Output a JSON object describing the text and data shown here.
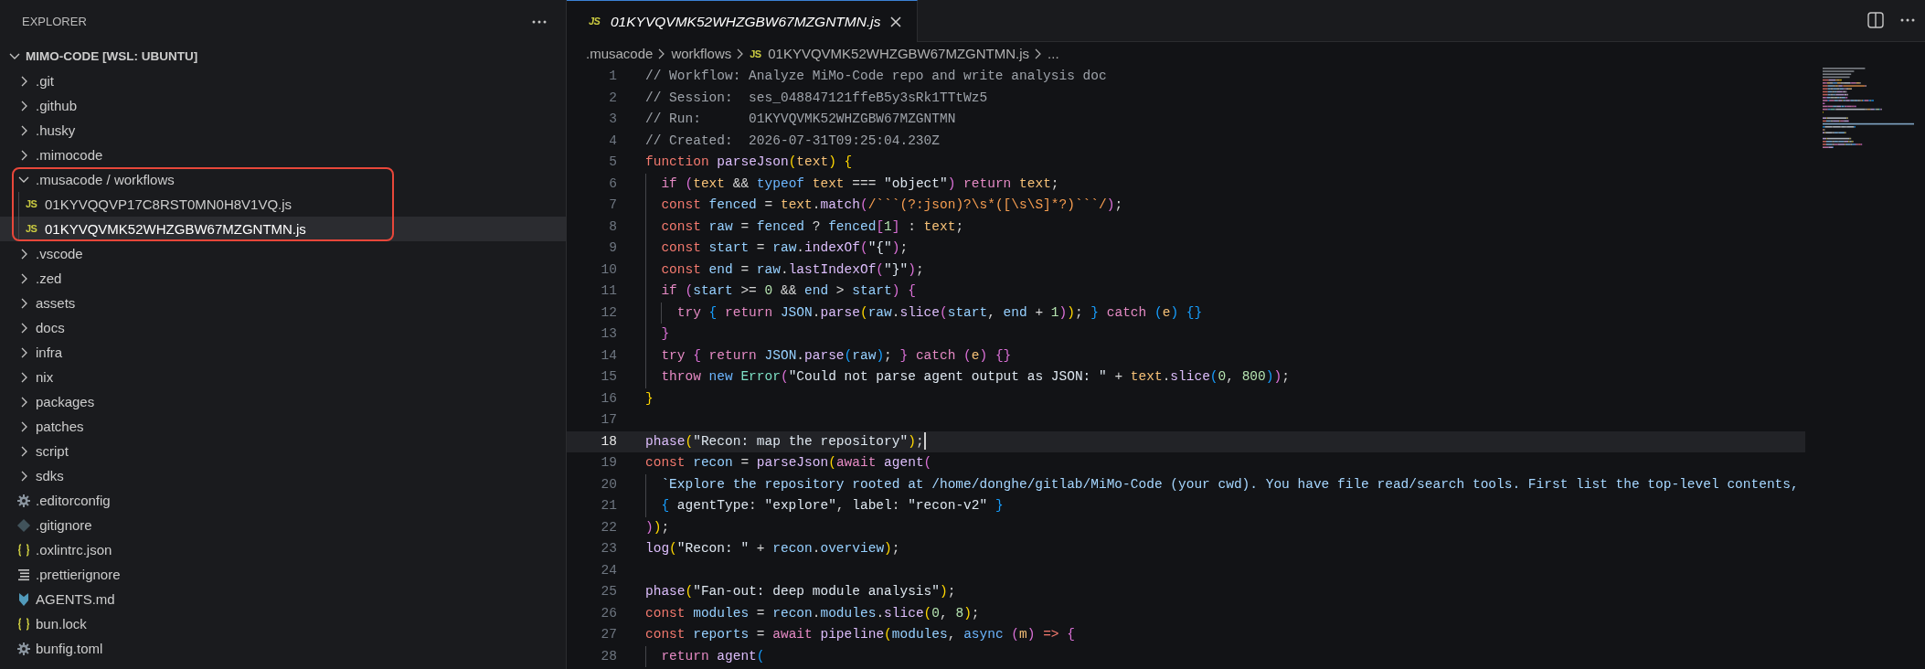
{
  "explorer": {
    "title": "EXPLORER",
    "root": {
      "label": "MIMO-CODE [WSL: UBUNTU]",
      "expanded": true,
      "children": [
        {
          "label": ".git",
          "kind": "folder",
          "expanded": false
        },
        {
          "label": ".github",
          "kind": "folder",
          "expanded": false
        },
        {
          "label": ".husky",
          "kind": "folder",
          "expanded": false
        },
        {
          "label": ".mimocode",
          "kind": "folder",
          "expanded": false
        },
        {
          "label": ".musacode / workflows",
          "kind": "folder",
          "expanded": true,
          "annotated": true,
          "children": [
            {
              "label": "01KYVQQVP17C8RST0MN0H8V1VQ.js",
              "kind": "js",
              "badge": "JS",
              "selected": false
            },
            {
              "label": "01KYVQVMK52WHZGBW67MZGNTMN.js",
              "kind": "js",
              "badge": "JS",
              "selected": true
            }
          ]
        },
        {
          "label": ".vscode",
          "kind": "folder",
          "expanded": false
        },
        {
          "label": ".zed",
          "kind": "folder",
          "expanded": false
        },
        {
          "label": "assets",
          "kind": "folder",
          "expanded": false
        },
        {
          "label": "docs",
          "kind": "folder",
          "expanded": false
        },
        {
          "label": "infra",
          "kind": "folder",
          "expanded": false
        },
        {
          "label": "nix",
          "kind": "folder",
          "expanded": false
        },
        {
          "label": "packages",
          "kind": "folder",
          "expanded": false
        },
        {
          "label": "patches",
          "kind": "folder",
          "expanded": false
        },
        {
          "label": "script",
          "kind": "folder",
          "expanded": false
        },
        {
          "label": "sdks",
          "kind": "folder",
          "expanded": false
        },
        {
          "label": ".editorconfig",
          "kind": "config",
          "selected": false
        },
        {
          "label": ".gitignore",
          "kind": "git",
          "selected": false
        },
        {
          "label": ".oxlintrc.json",
          "kind": "json",
          "selected": false
        },
        {
          "label": ".prettierignore",
          "kind": "text",
          "selected": false
        },
        {
          "label": "AGENTS.md",
          "kind": "markdown",
          "selected": false
        },
        {
          "label": "bun.lock",
          "kind": "json",
          "selected": false
        },
        {
          "label": "bunfig.toml",
          "kind": "config",
          "selected": false
        }
      ]
    }
  },
  "tabs": [
    {
      "label": "01KYVQVMK52WHZGBW67MZGNTMN.js",
      "badge": "JS",
      "selected": true,
      "preview": true
    }
  ],
  "breadcrumbs": [
    {
      "label": ".musacode"
    },
    {
      "label": "workflows"
    },
    {
      "label": "01KYVQVMK52WHZGBW67MZGNTMN.js",
      "badge": "JS"
    },
    {
      "label": "..."
    }
  ],
  "code": {
    "lines": [
      {
        "number": "1",
        "current": false,
        "tokens": [
          {
            "kind": "comment",
            "text": "// Workflow: Analyze MiMo-Code repo and write analysis doc"
          }
        ]
      },
      {
        "number": "2",
        "current": false,
        "tokens": [
          {
            "kind": "comment",
            "text": "// Session:  ses_048847121ffeB5y3sRk1TTtWz5"
          }
        ]
      },
      {
        "number": "3",
        "current": false,
        "tokens": [
          {
            "kind": "comment",
            "text": "// Run:      01KYVQVMK52WHZGBW67MZGNTMN"
          }
        ]
      },
      {
        "number": "4",
        "current": false,
        "tokens": [
          {
            "kind": "comment",
            "text": "// Created:  2026-07-31T09:25:04.230Z"
          }
        ]
      },
      {
        "number": "5",
        "current": false,
        "tokens": [
          {
            "kind": "storage",
            "text": "function"
          },
          {
            "kind": "func",
            "text": " parseJson"
          },
          {
            "kind": "b1",
            "text": "("
          },
          {
            "kind": "param",
            "text": "text"
          },
          {
            "kind": "b1",
            "text": ")"
          },
          {
            "kind": "b1",
            "text": " {"
          }
        ]
      },
      {
        "number": "6",
        "current": false,
        "tokens": [
          {
            "kind": "control",
            "text": "  if"
          },
          {
            "kind": "b2",
            "text": " ("
          },
          {
            "kind": "param",
            "text": "text"
          },
          {
            "kind": "plain",
            "text": " && "
          },
          {
            "kind": "opkw",
            "text": "typeof"
          },
          {
            "kind": "param",
            "text": " text"
          },
          {
            "kind": "plain",
            "text": " === "
          },
          {
            "kind": "string",
            "text": "\"object\""
          },
          {
            "kind": "b2",
            "text": ")"
          },
          {
            "kind": "control",
            "text": " return"
          },
          {
            "kind": "param",
            "text": " text"
          },
          {
            "kind": "plain",
            "text": ";"
          }
        ]
      },
      {
        "number": "7",
        "current": false,
        "tokens": [
          {
            "kind": "storage",
            "text": "  const"
          },
          {
            "kind": "var",
            "text": " fenced"
          },
          {
            "kind": "plain",
            "text": " = "
          },
          {
            "kind": "param",
            "text": "text"
          },
          {
            "kind": "plain",
            "text": "."
          },
          {
            "kind": "func",
            "text": "match"
          },
          {
            "kind": "b2",
            "text": "("
          },
          {
            "kind": "regex",
            "text": "/```(?:json)?\\s*([\\s\\S]*?)```/"
          },
          {
            "kind": "b2",
            "text": ")"
          },
          {
            "kind": "plain",
            "text": ";"
          }
        ]
      },
      {
        "number": "8",
        "current": false,
        "tokens": [
          {
            "kind": "storage",
            "text": "  const"
          },
          {
            "kind": "var",
            "text": " raw"
          },
          {
            "kind": "plain",
            "text": " = "
          },
          {
            "kind": "var",
            "text": "fenced"
          },
          {
            "kind": "plain",
            "text": " ? "
          },
          {
            "kind": "var",
            "text": "fenced"
          },
          {
            "kind": "b2",
            "text": "["
          },
          {
            "kind": "number",
            "text": "1"
          },
          {
            "kind": "b2",
            "text": "]"
          },
          {
            "kind": "plain",
            "text": " : "
          },
          {
            "kind": "param",
            "text": "text"
          },
          {
            "kind": "plain",
            "text": ";"
          }
        ]
      },
      {
        "number": "9",
        "current": false,
        "tokens": [
          {
            "kind": "storage",
            "text": "  const"
          },
          {
            "kind": "var",
            "text": " start"
          },
          {
            "kind": "plain",
            "text": " = "
          },
          {
            "kind": "var",
            "text": "raw"
          },
          {
            "kind": "plain",
            "text": "."
          },
          {
            "kind": "func",
            "text": "indexOf"
          },
          {
            "kind": "b2",
            "text": "("
          },
          {
            "kind": "string",
            "text": "\"{\""
          },
          {
            "kind": "b2",
            "text": ")"
          },
          {
            "kind": "plain",
            "text": ";"
          }
        ]
      },
      {
        "number": "10",
        "current": false,
        "tokens": [
          {
            "kind": "storage",
            "text": "  const"
          },
          {
            "kind": "var",
            "text": " end"
          },
          {
            "kind": "plain",
            "text": " = "
          },
          {
            "kind": "var",
            "text": "raw"
          },
          {
            "kind": "plain",
            "text": "."
          },
          {
            "kind": "func",
            "text": "lastIndexOf"
          },
          {
            "kind": "b2",
            "text": "("
          },
          {
            "kind": "string",
            "text": "\"}\""
          },
          {
            "kind": "b2",
            "text": ")"
          },
          {
            "kind": "plain",
            "text": ";"
          }
        ]
      },
      {
        "number": "11",
        "current": false,
        "tokens": [
          {
            "kind": "control",
            "text": "  if"
          },
          {
            "kind": "b2",
            "text": " ("
          },
          {
            "kind": "var",
            "text": "start"
          },
          {
            "kind": "plain",
            "text": " >= "
          },
          {
            "kind": "number",
            "text": "0"
          },
          {
            "kind": "plain",
            "text": " && "
          },
          {
            "kind": "var",
            "text": "end"
          },
          {
            "kind": "plain",
            "text": " > "
          },
          {
            "kind": "var",
            "text": "start"
          },
          {
            "kind": "b2",
            "text": ")"
          },
          {
            "kind": "b2",
            "text": " {"
          }
        ]
      },
      {
        "number": "12",
        "current": false,
        "tokens": [
          {
            "kind": "control",
            "text": "    try"
          },
          {
            "kind": "b3",
            "text": " {"
          },
          {
            "kind": "control",
            "text": " return"
          },
          {
            "kind": "var",
            "text": " JSON"
          },
          {
            "kind": "plain",
            "text": "."
          },
          {
            "kind": "func",
            "text": "parse"
          },
          {
            "kind": "b1",
            "text": "("
          },
          {
            "kind": "var",
            "text": "raw"
          },
          {
            "kind": "plain",
            "text": "."
          },
          {
            "kind": "func",
            "text": "slice"
          },
          {
            "kind": "b2",
            "text": "("
          },
          {
            "kind": "var",
            "text": "start"
          },
          {
            "kind": "plain",
            "text": ", "
          },
          {
            "kind": "var",
            "text": "end"
          },
          {
            "kind": "plain",
            "text": " + "
          },
          {
            "kind": "number",
            "text": "1"
          },
          {
            "kind": "b2",
            "text": ")"
          },
          {
            "kind": "b1",
            "text": ")"
          },
          {
            "kind": "plain",
            "text": ";"
          },
          {
            "kind": "b3",
            "text": " }"
          },
          {
            "kind": "control",
            "text": " catch"
          },
          {
            "kind": "b3",
            "text": " ("
          },
          {
            "kind": "param",
            "text": "e"
          },
          {
            "kind": "b3",
            "text": ")"
          },
          {
            "kind": "b3",
            "text": " {}"
          }
        ]
      },
      {
        "number": "13",
        "current": false,
        "tokens": [
          {
            "kind": "b2",
            "text": "  }"
          }
        ]
      },
      {
        "number": "14",
        "current": false,
        "tokens": [
          {
            "kind": "control",
            "text": "  try"
          },
          {
            "kind": "b2",
            "text": " {"
          },
          {
            "kind": "control",
            "text": " return"
          },
          {
            "kind": "var",
            "text": " JSON"
          },
          {
            "kind": "plain",
            "text": "."
          },
          {
            "kind": "func",
            "text": "parse"
          },
          {
            "kind": "b3",
            "text": "("
          },
          {
            "kind": "var",
            "text": "raw"
          },
          {
            "kind": "b3",
            "text": ")"
          },
          {
            "kind": "plain",
            "text": ";"
          },
          {
            "kind": "b2",
            "text": " }"
          },
          {
            "kind": "control",
            "text": " catch"
          },
          {
            "kind": "b2",
            "text": " ("
          },
          {
            "kind": "param",
            "text": "e"
          },
          {
            "kind": "b2",
            "text": ")"
          },
          {
            "kind": "b2",
            "text": " {}"
          }
        ]
      },
      {
        "number": "15",
        "current": false,
        "tokens": [
          {
            "kind": "control",
            "text": "  throw"
          },
          {
            "kind": "opkw",
            "text": " new"
          },
          {
            "kind": "type",
            "text": " Error"
          },
          {
            "kind": "b2",
            "text": "("
          },
          {
            "kind": "string",
            "text": "\"Could not parse agent output as JSON: \""
          },
          {
            "kind": "plain",
            "text": " + "
          },
          {
            "kind": "param",
            "text": "text"
          },
          {
            "kind": "plain",
            "text": "."
          },
          {
            "kind": "func",
            "text": "slice"
          },
          {
            "kind": "b3",
            "text": "("
          },
          {
            "kind": "number",
            "text": "0"
          },
          {
            "kind": "plain",
            "text": ", "
          },
          {
            "kind": "number",
            "text": "800"
          },
          {
            "kind": "b3",
            "text": ")"
          },
          {
            "kind": "b2",
            "text": ")"
          },
          {
            "kind": "plain",
            "text": ";"
          }
        ]
      },
      {
        "number": "16",
        "current": false,
        "tokens": [
          {
            "kind": "b1",
            "text": "}"
          }
        ]
      },
      {
        "number": "17",
        "current": false
      },
      {
        "number": "18",
        "current": true,
        "tokens": [
          {
            "kind": "func",
            "text": "phase"
          },
          {
            "kind": "b1",
            "text": "("
          },
          {
            "kind": "string",
            "text": "\"Recon: map the repository\""
          },
          {
            "kind": "b1",
            "text": ")"
          },
          {
            "kind": "plain",
            "text": ";"
          }
        ]
      },
      {
        "number": "19",
        "current": false,
        "tokens": [
          {
            "kind": "storage",
            "text": "const"
          },
          {
            "kind": "var",
            "text": " recon"
          },
          {
            "kind": "plain",
            "text": " = "
          },
          {
            "kind": "func",
            "text": "parseJson"
          },
          {
            "kind": "b1",
            "text": "("
          },
          {
            "kind": "control",
            "text": "await"
          },
          {
            "kind": "func",
            "text": " agent"
          },
          {
            "kind": "b2",
            "text": "("
          }
        ]
      },
      {
        "number": "20",
        "current": false,
        "tokens": [
          {
            "kind": "template",
            "text": "  `Explore the repository rooted at /home/donghe/gitlab/MiMo-Code (your cwd). You have file read/search tools. First list the top-level contents,"
          }
        ]
      },
      {
        "number": "21",
        "current": false,
        "tokens": [
          {
            "kind": "b3",
            "text": "  {"
          },
          {
            "kind": "prop",
            "text": " agentType"
          },
          {
            "kind": "plain",
            "text": ": "
          },
          {
            "kind": "string",
            "text": "\"explore\""
          },
          {
            "kind": "plain",
            "text": ", "
          },
          {
            "kind": "prop",
            "text": "label"
          },
          {
            "kind": "plain",
            "text": ": "
          },
          {
            "kind": "string",
            "text": "\"recon-v2\""
          },
          {
            "kind": "b3",
            "text": " }"
          }
        ]
      },
      {
        "number": "22",
        "current": false,
        "tokens": [
          {
            "kind": "b2",
            "text": ")"
          },
          {
            "kind": "b1",
            "text": ")"
          },
          {
            "kind": "plain",
            "text": ";"
          }
        ]
      },
      {
        "number": "23",
        "current": false,
        "tokens": [
          {
            "kind": "func",
            "text": "log"
          },
          {
            "kind": "b1",
            "text": "("
          },
          {
            "kind": "string",
            "text": "\"Recon: \""
          },
          {
            "kind": "plain",
            "text": " + "
          },
          {
            "kind": "var",
            "text": "recon"
          },
          {
            "kind": "plain",
            "text": "."
          },
          {
            "kind": "var",
            "text": "overview"
          },
          {
            "kind": "b1",
            "text": ")"
          },
          {
            "kind": "plain",
            "text": ";"
          }
        ]
      },
      {
        "number": "24",
        "current": false
      },
      {
        "number": "25",
        "current": false,
        "tokens": [
          {
            "kind": "func",
            "text": "phase"
          },
          {
            "kind": "b1",
            "text": "("
          },
          {
            "kind": "string",
            "text": "\"Fan-out: deep module analysis\""
          },
          {
            "kind": "b1",
            "text": ")"
          },
          {
            "kind": "plain",
            "text": ";"
          }
        ]
      },
      {
        "number": "26",
        "current": false,
        "tokens": [
          {
            "kind": "storage",
            "text": "const"
          },
          {
            "kind": "var",
            "text": " modules"
          },
          {
            "kind": "plain",
            "text": " = "
          },
          {
            "kind": "var",
            "text": "recon"
          },
          {
            "kind": "plain",
            "text": "."
          },
          {
            "kind": "var",
            "text": "modules"
          },
          {
            "kind": "plain",
            "text": "."
          },
          {
            "kind": "func",
            "text": "slice"
          },
          {
            "kind": "b1",
            "text": "("
          },
          {
            "kind": "number",
            "text": "0"
          },
          {
            "kind": "plain",
            "text": ", "
          },
          {
            "kind": "number",
            "text": "8"
          },
          {
            "kind": "b1",
            "text": ")"
          },
          {
            "kind": "plain",
            "text": ";"
          }
        ]
      },
      {
        "number": "27",
        "current": false,
        "tokens": [
          {
            "kind": "storage",
            "text": "const"
          },
          {
            "kind": "var",
            "text": " reports"
          },
          {
            "kind": "plain",
            "text": " = "
          },
          {
            "kind": "control",
            "text": "await"
          },
          {
            "kind": "func",
            "text": " pipeline"
          },
          {
            "kind": "b1",
            "text": "("
          },
          {
            "kind": "var",
            "text": "modules"
          },
          {
            "kind": "plain",
            "text": ", "
          },
          {
            "kind": "opkw",
            "text": "async"
          },
          {
            "kind": "b2",
            "text": " ("
          },
          {
            "kind": "param",
            "text": "m"
          },
          {
            "kind": "b2",
            "text": ")"
          },
          {
            "kind": "storage",
            "text": " =>"
          },
          {
            "kind": "b2",
            "text": " {"
          }
        ]
      },
      {
        "number": "28",
        "current": false,
        "tokens": [
          {
            "kind": "control",
            "text": "  return"
          },
          {
            "kind": "func",
            "text": " agent"
          },
          {
            "kind": "b3",
            "text": "("
          }
        ]
      }
    ]
  }
}
